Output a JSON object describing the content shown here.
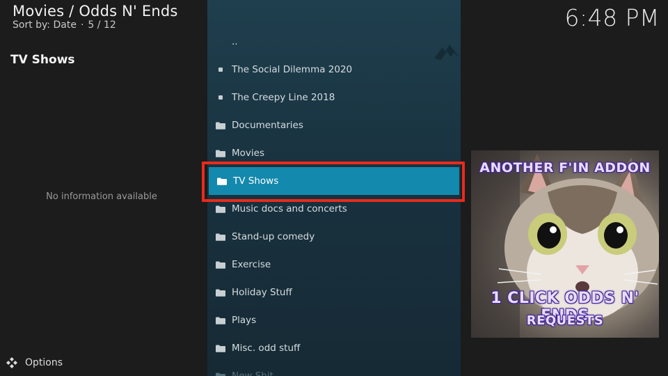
{
  "header": {
    "breadcrumb": "Movies / Odds N' Ends",
    "sort_label": "Sort by: Date",
    "position": "5 / 12",
    "clock": "6:48 PM"
  },
  "info": {
    "title": "TV Shows",
    "empty_text": "No information available"
  },
  "list": {
    "items": [
      {
        "label": "..",
        "icon": "none"
      },
      {
        "label": "The Social Dilemma 2020",
        "icon": "dot-icon"
      },
      {
        "label": "The Creepy Line 2018",
        "icon": "dot-icon"
      },
      {
        "label": "Documentaries",
        "icon": "folder-icon"
      },
      {
        "label": "Movies",
        "icon": "folder-icon"
      },
      {
        "label": "TV Shows",
        "icon": "folder-icon"
      },
      {
        "label": "Music docs and concerts",
        "icon": "folder-icon"
      },
      {
        "label": "Stand-up comedy",
        "icon": "folder-icon"
      },
      {
        "label": "Exercise",
        "icon": "folder-icon"
      },
      {
        "label": "Holiday Stuff",
        "icon": "folder-icon"
      },
      {
        "label": "Plays",
        "icon": "folder-icon"
      },
      {
        "label": "Misc. odd stuff",
        "icon": "folder-icon"
      },
      {
        "label": "New Shit",
        "icon": "folder-icon"
      }
    ],
    "selected_label": "TV Shows"
  },
  "thumbnail": {
    "caption_top": "ANOTHER F'IN ADDON",
    "caption_mid": "1 CLICK ODDS N' ENDS",
    "caption_bottom": "REQUESTS"
  },
  "footer": {
    "options_label": "Options"
  },
  "colors": {
    "selected_bg": "#1389ad",
    "highlight_border": "#ea2a1d",
    "panel_bg": "#1f3f4e",
    "caption_outline": "#4b2fa0"
  }
}
